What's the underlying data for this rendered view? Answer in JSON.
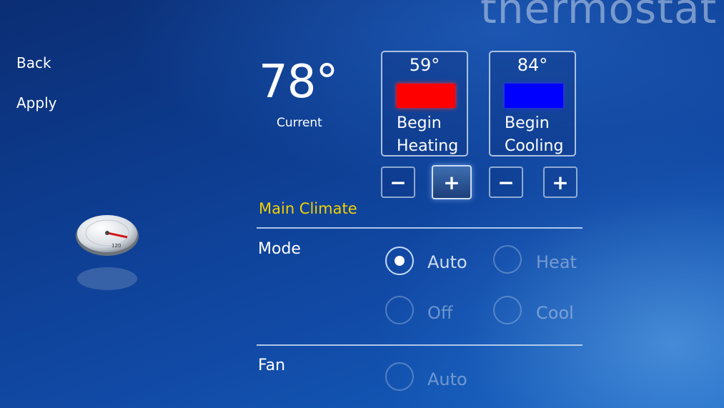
{
  "app": {
    "title": "thermostat"
  },
  "nav": {
    "back": "Back",
    "apply": "Apply"
  },
  "current": {
    "temp": "78°",
    "label": "Current"
  },
  "heating": {
    "temp": "59°",
    "label_line1": "Begin",
    "label_line2": "Heating",
    "color": "#ff0000"
  },
  "cooling": {
    "temp": "84°",
    "label_line1": "Begin",
    "label_line2": "Cooling",
    "color": "#0000ff"
  },
  "controls": {
    "minus": "−",
    "plus": "+"
  },
  "main_climate": {
    "title": "Main Climate",
    "mode": {
      "label": "Mode",
      "selected": "Auto",
      "options": [
        "Auto",
        "Heat",
        "Off",
        "Cool"
      ]
    },
    "fan": {
      "label": "Fan",
      "options": [
        "Auto"
      ]
    }
  },
  "colors": {
    "section_title": "#f5d000",
    "background": "#0d3c8f"
  }
}
